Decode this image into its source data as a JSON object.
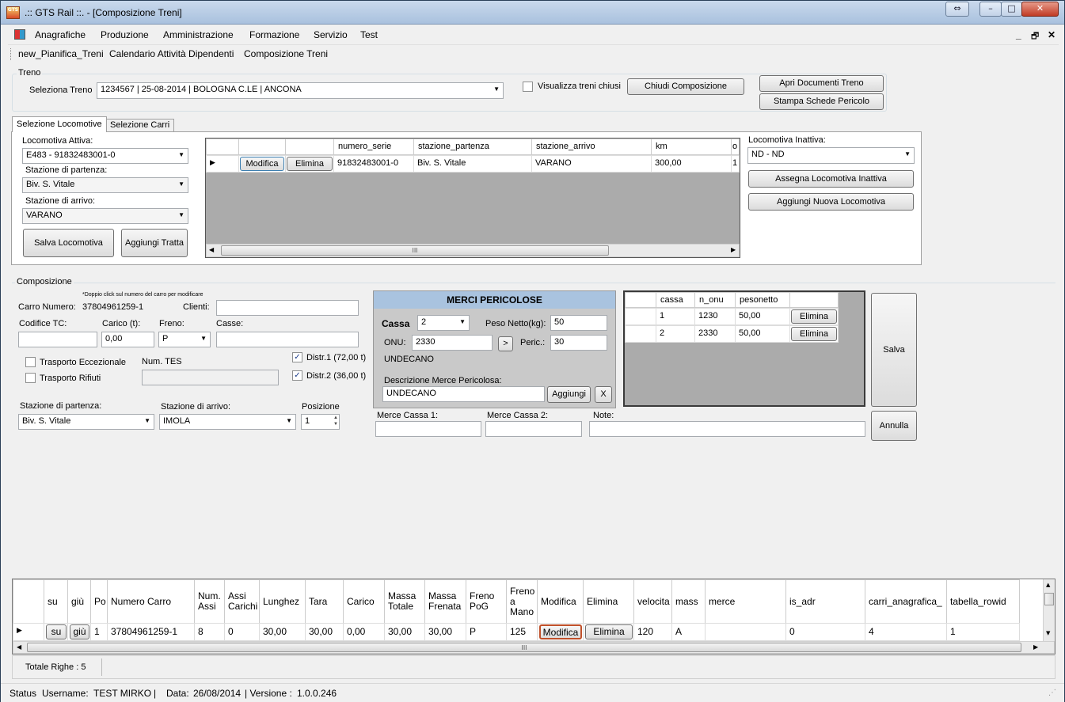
{
  "window": {
    "title": ".:: GTS Rail ::. - [Composizione Treni]",
    "icon_text": "GTS",
    "controls": [
      "⇔",
      "–",
      "□",
      "✕"
    ]
  },
  "menu": [
    "Anagrafiche",
    "Produzione",
    "Amministrazione",
    "Formazione",
    "Servizio",
    "Test"
  ],
  "mdi_controls": [
    "_",
    "🗗",
    "✕"
  ],
  "toolbar": [
    "new_Pianifica_Treni",
    "Calendario Attività Dipendenti",
    "Composizione Treni"
  ],
  "treno": {
    "group_label": "Treno",
    "seleziona_label": "Seleziona Treno",
    "seleziona_value": "1234567 | 25-08-2014 | BOLOGNA C.LE | ANCONA",
    "visualizza_chiusi_label": "Visualizza treni chiusi",
    "visualizza_chiusi_checked": false,
    "chiudi_composizione": "Chiudi Composizione",
    "apri_documenti": "Apri Documenti Treno",
    "stampa_schede": "Stampa Schede Pericolo"
  },
  "tabs": [
    "Selezione Locomotive",
    "Selezione Carri"
  ],
  "locomotive": {
    "attiva_label": "Locomotiva Attiva:",
    "attiva_value": "E483 - 91832483001-0",
    "partenza_label": "Stazione di partenza:",
    "partenza_value": "Biv. S. Vitale",
    "arrivo_label": "Stazione di arrivo:",
    "arrivo_value": "VARANO",
    "salva": "Salva Locomotiva",
    "aggiungi_tratta": "Aggiungi Tratta",
    "grid_headers": [
      "numero_serie",
      "stazione_partenza",
      "stazione_arrivo",
      "km",
      "o"
    ],
    "grid_rows": [
      {
        "modifica": "Modifica",
        "elimina": "Elimina",
        "numero_serie": "91832483001-0",
        "stazione_partenza": "Biv. S. Vitale",
        "stazione_arrivo": "VARANO",
        "km": "300,00",
        "o": "1"
      }
    ],
    "inattiva_label": "Locomotiva Inattiva:",
    "inattiva_value": "ND - ND",
    "assegna_inattiva": "Assegna Locomotiva Inattiva",
    "aggiungi_nuova": "Aggiungi Nuova Locomotiva"
  },
  "composizione": {
    "group_label": "Composizione",
    "hint": "*Doppio click sul numero del carro per modificare",
    "carro_numero_label": "Carro Numero:",
    "carro_numero_value": "37804961259-1",
    "clienti_label": "Clienti:",
    "clienti_value": "",
    "codifice_tc_label": "Codifice TC:",
    "codifice_tc_value": "",
    "carico_label": "Carico (t):",
    "carico_value": "0,00",
    "freno_label": "Freno:",
    "freno_value": "P",
    "casse_label": "Casse:",
    "casse_value": "",
    "trasporto_eccezionale": "Trasporto Eccezionale",
    "trasporto_rifiuti": "Trasporto Rifiuti",
    "num_tes_label": "Num. TES",
    "num_tes_value": "",
    "distr1": "Distr.1 (72,00 t)",
    "distr2": "Distr.2 (36,00 t)",
    "partenza_label": "Stazione di partenza:",
    "partenza_value": "Biv. S. Vitale",
    "arrivo_label": "Stazione di arrivo:",
    "arrivo_value": "IMOLA",
    "posizione_label": "Posizione",
    "posizione_value": "1"
  },
  "merci": {
    "title": "MERCI PERICOLOSE",
    "cassa_label": "Cassa",
    "cassa_value": "2",
    "peso_label": "Peso Netto(kg):",
    "peso_value": "50",
    "onu_label": "ONU:",
    "onu_value": "2330",
    "go_button": ">",
    "peric_label": "Peric.:",
    "peric_value": "30",
    "nome": "UNDECANO",
    "descrizione_label": "Descrizione Merce Pericolosa:",
    "descrizione_value": "UNDECANO",
    "aggiungi": "Aggiungi",
    "x_button": "X",
    "merce_cassa1_label": "Merce Cassa 1:",
    "merce_cassa2_label": "Merce Cassa 2:",
    "note_label": "Note:"
  },
  "merci_grid": {
    "headers": [
      "cassa",
      "n_onu",
      "pesonetto"
    ],
    "rows": [
      {
        "cassa": "1",
        "n_onu": "1230",
        "pesonetto": "50,00",
        "elimina": "Elimina"
      },
      {
        "cassa": "2",
        "n_onu": "2330",
        "pesonetto": "50,00",
        "elimina": "Elimina"
      }
    ]
  },
  "actions": {
    "salva": "Salva",
    "annulla": "Annulla"
  },
  "carri_grid": {
    "headers": [
      "su",
      "giù",
      "Po",
      "Numero Carro",
      "Num. Assi",
      "Assi Carichi",
      "Lunghez",
      "Tara",
      "Carico",
      "Massa Totale",
      "Massa Frenata",
      "Freno PoG",
      "Freno a Mano",
      "Modifica",
      "Elimina",
      "velocita",
      "mass",
      "merce",
      "is_adr",
      "carri_anagrafica_",
      "tabella_rowid"
    ],
    "row": [
      "su",
      "giù",
      "1",
      "37804961259-1",
      "8",
      "0",
      "30,00",
      "30,00",
      "0,00",
      "30,00",
      "30,00",
      "P",
      "125",
      "Modifica",
      "Elimina",
      "120",
      "A",
      "",
      "0",
      "4",
      "1"
    ],
    "totale": "Totale Righe : 5"
  },
  "status": {
    "text": "Status",
    "username_label": "Username:",
    "username": "TEST MIRKO",
    "data_label": "Data:",
    "data": "26/08/2014",
    "versione_label": "| Versione :",
    "versione": "1.0.0.246"
  }
}
